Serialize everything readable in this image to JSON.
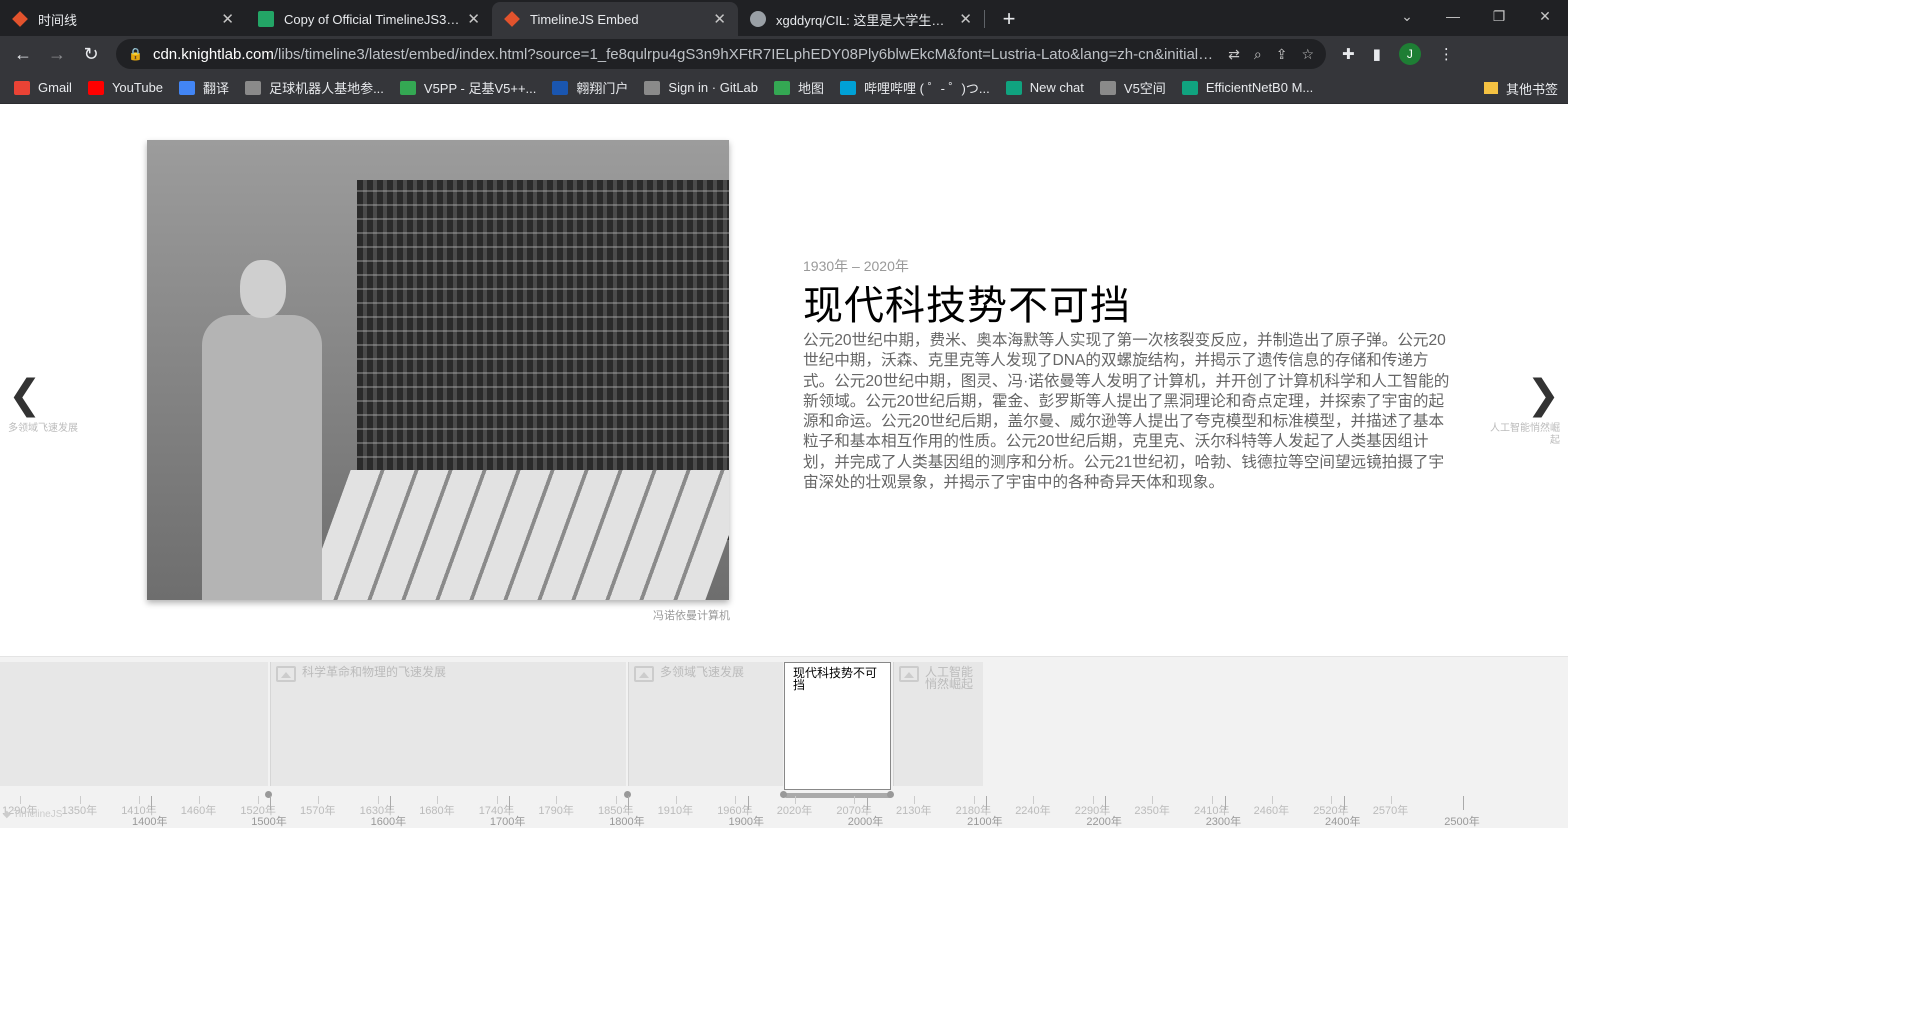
{
  "browser": {
    "tabs": [
      {
        "title": "时间线",
        "favicon_color": "#e2532d",
        "active": false
      },
      {
        "title": "Copy of Official TimelineJS3 Te",
        "favicon_color": "#23a566",
        "active": false
      },
      {
        "title": "TimelineJS Embed",
        "favicon_color": "#e2532d",
        "active": true
      },
      {
        "title": "xgddyrq/CIL: 这里是大学生信息",
        "favicon_color": "#9aa0a6",
        "active": false
      }
    ],
    "close_glyph": "✕",
    "new_tab_glyph": "+",
    "address": {
      "host": "cdn.knightlab.com",
      "path": "/libs/timeline3/latest/embed/index.html?source=1_fe8qulrpu4gS3n9hXFtR7IELphEDY08Ply6blwEkcM&font=Lustria-Lato&lang=zh-cn&initial_zoom..."
    },
    "profile_initial": "J",
    "bookmarks": [
      {
        "label": "Gmail",
        "color": "#ea4335"
      },
      {
        "label": "YouTube",
        "color": "#ff0000"
      },
      {
        "label": "翻译",
        "color": "#4285f4"
      },
      {
        "label": "足球机器人基地参...",
        "color": "#8a8a8a"
      },
      {
        "label": "V5PP - 足基V5++...",
        "color": "#34a853"
      },
      {
        "label": "翱翔门户",
        "color": "#1a56b0"
      },
      {
        "label": "Sign in · GitLab",
        "color": "#8a8a8a"
      },
      {
        "label": "地图",
        "color": "#34a853"
      },
      {
        "label": "哔哩哔哩 ( ゜- ゜)つ...",
        "color": "#00a1d6"
      },
      {
        "label": "New chat",
        "color": "#10a37f"
      },
      {
        "label": "V5空间",
        "color": "#8a8a8a"
      },
      {
        "label": "EfficientNetB0 M...",
        "color": "#10a37f"
      }
    ],
    "other_bookmarks": "其他书签"
  },
  "slide": {
    "date_range": "1930年 – 2020年",
    "headline": "现代科技势不可挡",
    "text": "公元20世纪中期，费米、奥本海默等人实现了第一次核裂变反应，并制造出了原子弹。公元20世纪中期，沃森、克里克等人发现了DNA的双螺旋结构，并揭示了遗传信息的存储和传递方式。公元20世纪中期，图灵、冯·诺依曼等人发明了计算机，并开创了计算机科学和人工智能的新领域。公元20世纪后期，霍金、彭罗斯等人提出了黑洞理论和奇点定理，并探索了宇宙的起源和命运。公元20世纪后期，盖尔曼、威尔逊等人提出了夸克模型和标准模型，并描述了基本粒子和基本相互作用的性质。公元20世纪后期，克里克、沃尔科特等人发起了人类基因组计划，并完成了人类基因组的测序和分析。公元21世纪初，哈勃、钱德拉等空间望远镜拍摄了宇宙深处的壮观景象，并揭示了宇宙中的各种奇异天体和现象。",
    "media_caption": "冯诺依曼计算机",
    "prev_label": "多领域飞速发展",
    "next_label": "人工智能悄然崛起",
    "prev_glyph": "❮",
    "next_glyph": "❯"
  },
  "timenav": {
    "zoom_in_glyph": "⊕",
    "zoom_out_glyph": "⊖",
    "back_glyph": "↪",
    "forward_glyph": "↩",
    "markers": [
      {
        "title": "科学革命和物理的飞速发展",
        "active": false
      },
      {
        "title": "多领域飞速发展",
        "active": false
      },
      {
        "title": "现代科技势不可挡",
        "active": true
      },
      {
        "title": "人工智能悄然崛起",
        "active": false
      }
    ],
    "axis_minor": [
      "1290年",
      "1350年",
      "1410年",
      "1460年",
      "1520年",
      "1570年",
      "1630年",
      "1680年",
      "1740年",
      "1790年",
      "1850年",
      "1910年",
      "1960年",
      "2020年",
      "2070年",
      "2130年",
      "2180年",
      "2240年",
      "2290年",
      "2350年",
      "2410年",
      "2460年",
      "2520年",
      "2570年"
    ],
    "axis_major": [
      "1400年",
      "1500年",
      "1600年",
      "1700年",
      "1800年",
      "1900年",
      "2000年",
      "2100年",
      "2200年",
      "2300年",
      "2400年",
      "2500年"
    ],
    "brand": "◆ TimelineJS"
  }
}
